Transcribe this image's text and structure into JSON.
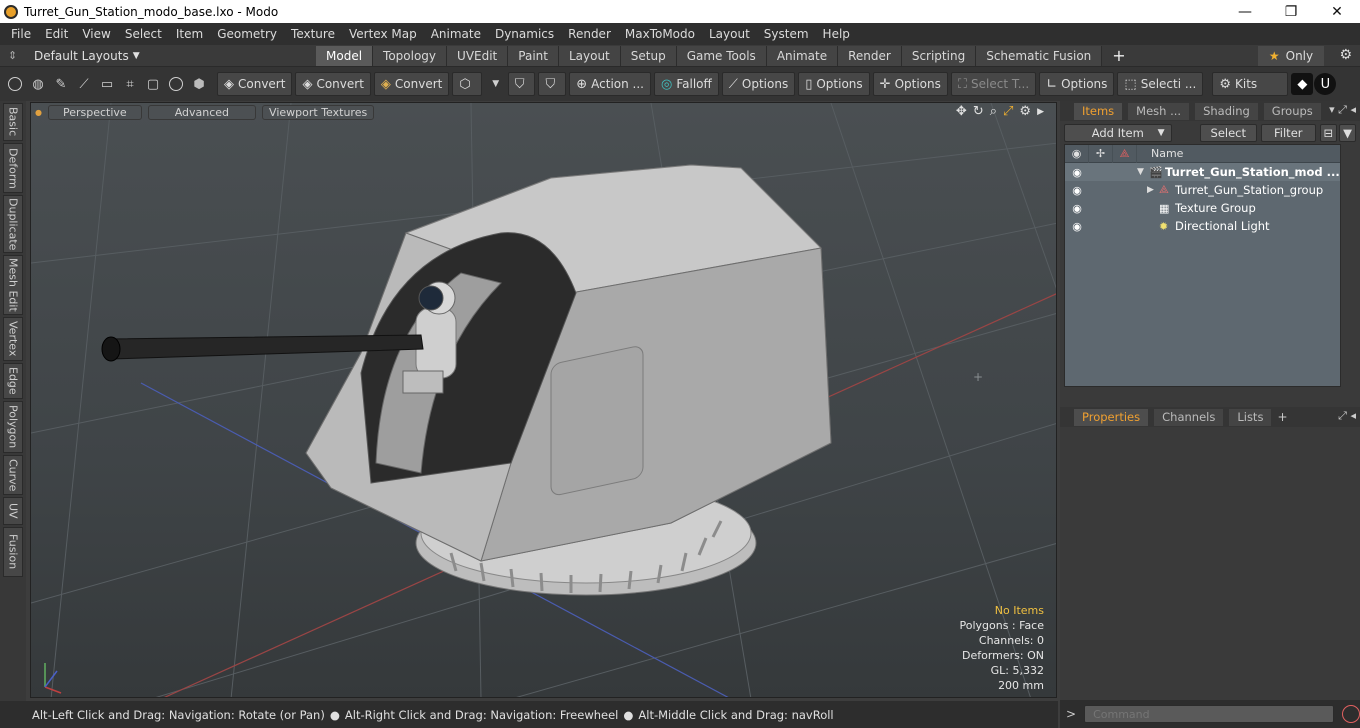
{
  "window": {
    "title": "Turret_Gun_Station_modo_base.lxo - Modo",
    "minimize": "—",
    "maximize": "❐",
    "close": "✕"
  },
  "menu": [
    "File",
    "Edit",
    "View",
    "Select",
    "Item",
    "Geometry",
    "Texture",
    "Vertex Map",
    "Animate",
    "Dynamics",
    "Render",
    "MaxToModo",
    "Layout",
    "System",
    "Help"
  ],
  "layouts": {
    "dropdown": "Default Layouts",
    "tabs": [
      "Model",
      "Topology",
      "UVEdit",
      "Paint",
      "Layout",
      "Setup",
      "Game Tools",
      "Animate",
      "Render",
      "Scripting",
      "Schematic Fusion"
    ],
    "active_tab": "Model",
    "only_label": "Only"
  },
  "toolbar": {
    "convert_1": "Convert",
    "convert_2": "Convert",
    "convert_3": "Convert",
    "action": "Action ...",
    "falloff": "Falloff",
    "options_1": "Options",
    "options_2": "Options",
    "options_3": "Options",
    "select_t": "Select T...",
    "options_4": "Options",
    "selecti": "Selecti ...",
    "kits": "Kits"
  },
  "left_tabs": [
    "Basic",
    "Deform",
    "Duplicate",
    "Mesh Edit",
    "Vertex",
    "Edge",
    "Polygon",
    "Curve",
    "UV",
    "Fusion"
  ],
  "viewport": {
    "perspective": "Perspective",
    "advanced": "Advanced",
    "viewport_textures": "Viewport Textures",
    "stats": {
      "no_items": "No Items",
      "polygons": "Polygons : Face",
      "channels": "Channels: 0",
      "deformers": "Deformers: ON",
      "gl": "GL: 5,332",
      "size": "200 mm"
    }
  },
  "status": {
    "part1": "Alt-Left Click and Drag: Navigation: Rotate (or Pan)",
    "part2": "Alt-Right Click and Drag: Navigation: Freewheel",
    "part3": "Alt-Middle Click and Drag: navRoll"
  },
  "items_panel": {
    "tabs": [
      "Items",
      "Mesh ...",
      "Shading",
      "Groups"
    ],
    "active_tab": "Items",
    "add_item": "Add Item",
    "select": "Select",
    "filter": "Filter",
    "column_name": "Name",
    "rows": [
      {
        "label": "Turret_Gun_Station_mod ...",
        "bold": true
      },
      {
        "label": "Turret_Gun_Station_group",
        "bold": false
      },
      {
        "label": "Texture Group",
        "bold": false
      },
      {
        "label": "Directional Light",
        "bold": false
      }
    ]
  },
  "props_panel": {
    "tabs": [
      "Properties",
      "Channels",
      "Lists"
    ],
    "active_tab": "Properties"
  },
  "command": {
    "placeholder": "Command"
  },
  "colors": {
    "accent": "#f0a030",
    "viewport_bg": "#464b4e",
    "tree_bg": "#5e6870"
  }
}
